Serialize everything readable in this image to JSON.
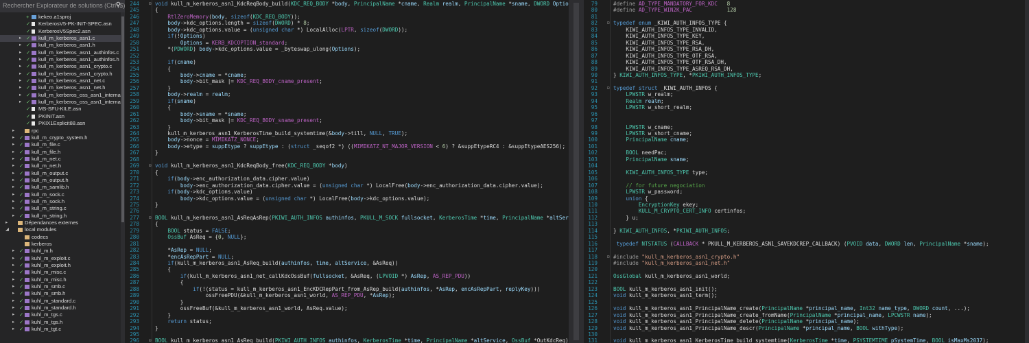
{
  "explorer": {
    "search_placeholder": "Rechercher Explorateur de solutions (Ctrl+$)",
    "items": [
      {
        "name": "kekeo.a1sproj",
        "depth": 3,
        "type": "proj",
        "check": "+",
        "caret": "",
        "sel": false
      },
      {
        "name": "KerberosV5-PK-INIT-SPEC.asn",
        "depth": 3,
        "type": "file",
        "check": "✓",
        "caret": "",
        "sel": false
      },
      {
        "name": "KerberosV5Spec2.asn",
        "depth": 3,
        "type": "file",
        "check": "✓",
        "caret": "",
        "sel": false
      },
      {
        "name": "kull_m_kerberos_asn1.c",
        "depth": 3,
        "type": "c",
        "check": "✓",
        "caret": "▸",
        "sel": true
      },
      {
        "name": "kull_m_kerberos_asn1.h",
        "depth": 3,
        "type": "h",
        "check": "✓",
        "caret": "▸",
        "sel": false
      },
      {
        "name": "kull_m_kerberos_asn1_authinfos.c",
        "depth": 3,
        "type": "c",
        "check": "✓",
        "caret": "▸",
        "sel": false
      },
      {
        "name": "kull_m_kerberos_asn1_authinfos.h",
        "depth": 3,
        "type": "h",
        "check": "✓",
        "caret": "▸",
        "sel": false
      },
      {
        "name": "kull_m_kerberos_asn1_crypto.c",
        "depth": 3,
        "type": "c",
        "check": "✓",
        "caret": "▸",
        "sel": false
      },
      {
        "name": "kull_m_kerberos_asn1_crypto.h",
        "depth": 3,
        "type": "h",
        "check": "✓",
        "caret": "▸",
        "sel": false
      },
      {
        "name": "kull_m_kerberos_asn1_net.c",
        "depth": 3,
        "type": "c",
        "check": "✓",
        "caret": "▸",
        "sel": false
      },
      {
        "name": "kull_m_kerberos_asn1_net.h",
        "depth": 3,
        "type": "h",
        "check": "✓",
        "caret": "▸",
        "sel": false
      },
      {
        "name": "kull_m_kerberos_oss_asn1_internal.h",
        "depth": 3,
        "type": "h",
        "check": "✓",
        "caret": "▸",
        "sel": false
      },
      {
        "name": "kull_m_kerberos_oss_asn1_internal_w",
        "depth": 3,
        "type": "h",
        "check": "✓",
        "caret": "▸",
        "sel": false
      },
      {
        "name": "MS-SFU-KILE.asn",
        "depth": 3,
        "type": "file",
        "check": "✓",
        "caret": "",
        "sel": false
      },
      {
        "name": "PKINIT.asn",
        "depth": 3,
        "type": "file",
        "check": "✓",
        "caret": "",
        "sel": false
      },
      {
        "name": "PKIX1Explicit88.asn",
        "depth": 3,
        "type": "file",
        "check": "✓",
        "caret": "",
        "sel": false
      },
      {
        "name": "rpc",
        "depth": 2,
        "type": "folder",
        "check": "",
        "caret": "▸",
        "sel": false
      },
      {
        "name": "kull_m_crypto_system.h",
        "depth": 2,
        "type": "h",
        "check": "✓",
        "caret": "▸",
        "sel": false
      },
      {
        "name": "kull_m_file.c",
        "depth": 2,
        "type": "c",
        "check": "✓",
        "caret": "▸",
        "sel": false
      },
      {
        "name": "kull_m_file.h",
        "depth": 2,
        "type": "h",
        "check": "✓",
        "caret": "▸",
        "sel": false
      },
      {
        "name": "kull_m_net.c",
        "depth": 2,
        "type": "c",
        "check": "✓",
        "caret": "▸",
        "sel": false
      },
      {
        "name": "kull_m_net.h",
        "depth": 2,
        "type": "h",
        "check": "✓",
        "caret": "▸",
        "sel": false
      },
      {
        "name": "kull_m_output.c",
        "depth": 2,
        "type": "c",
        "check": "✓",
        "caret": "▸",
        "sel": false
      },
      {
        "name": "kull_m_output.h",
        "depth": 2,
        "type": "h",
        "check": "✓",
        "caret": "▸",
        "sel": false
      },
      {
        "name": "kull_m_samlib.h",
        "depth": 2,
        "type": "h",
        "check": "✓",
        "caret": "▸",
        "sel": false
      },
      {
        "name": "kull_m_sock.c",
        "depth": 2,
        "type": "c",
        "check": "✓",
        "caret": "▸",
        "sel": false
      },
      {
        "name": "kull_m_sock.h",
        "depth": 2,
        "type": "h",
        "check": "✓",
        "caret": "▸",
        "sel": false
      },
      {
        "name": "kull_m_string.c",
        "depth": 2,
        "type": "c",
        "check": "✓",
        "caret": "▸",
        "sel": false
      },
      {
        "name": "kull_m_string.h",
        "depth": 2,
        "type": "h",
        "check": "✓",
        "caret": "▸",
        "sel": false
      },
      {
        "name": "Dépendances externes",
        "depth": 1,
        "type": "dep",
        "check": "",
        "caret": "▸",
        "sel": false
      },
      {
        "name": "local modules",
        "depth": 1,
        "type": "folder",
        "check": "",
        "caret": "◢",
        "sel": false
      },
      {
        "name": "codecs",
        "depth": 2,
        "type": "folder",
        "check": "",
        "caret": "",
        "sel": false
      },
      {
        "name": "kerberos",
        "depth": 2,
        "type": "folder",
        "check": "",
        "caret": "",
        "sel": false
      },
      {
        "name": "kuhl_m.h",
        "depth": 2,
        "type": "h",
        "check": "✓",
        "caret": "▸",
        "sel": false
      },
      {
        "name": "kuhl_m_exploit.c",
        "depth": 2,
        "type": "c",
        "check": "✓",
        "caret": "▸",
        "sel": false
      },
      {
        "name": "kuhl_m_exploit.h",
        "depth": 2,
        "type": "h",
        "check": "✓",
        "caret": "▸",
        "sel": false
      },
      {
        "name": "kuhl_m_misc.c",
        "depth": 2,
        "type": "c",
        "check": "✓",
        "caret": "▸",
        "sel": false
      },
      {
        "name": "kuhl_m_misc.h",
        "depth": 2,
        "type": "h",
        "check": "✓",
        "caret": "▸",
        "sel": false
      },
      {
        "name": "kuhl_m_smb.c",
        "depth": 2,
        "type": "c",
        "check": "✓",
        "caret": "▸",
        "sel": false
      },
      {
        "name": "kuhl_m_smb.h",
        "depth": 2,
        "type": "h",
        "check": "✓",
        "caret": "▸",
        "sel": false
      },
      {
        "name": "kuhl_m_standard.c",
        "depth": 2,
        "type": "c",
        "check": "✓",
        "caret": "▸",
        "sel": false
      },
      {
        "name": "kuhl_m_standard.h",
        "depth": 2,
        "type": "h",
        "check": "✓",
        "caret": "▸",
        "sel": false
      },
      {
        "name": "kuhl_m_tgs.c",
        "depth": 2,
        "type": "c",
        "check": "✓",
        "caret": "▸",
        "sel": false
      },
      {
        "name": "kuhl_m_tgs.h",
        "depth": 2,
        "type": "h",
        "check": "✓",
        "caret": "▸",
        "sel": false
      },
      {
        "name": "kuhl_m_tgt.c",
        "depth": 2,
        "type": "c",
        "check": "✓",
        "caret": "▸",
        "sel": false
      }
    ]
  },
  "colors": {
    "keyword": "#569cd6",
    "type": "#4ec9b0",
    "macro": "#bd63c5",
    "string": "#d69d85",
    "comment": "#57a64a",
    "number": "#b5cea8",
    "text": "#dcdcdc",
    "linenum": "#2b91af",
    "csharp_check": "#6fc26f",
    "c_icon": "#9b77c7",
    "h_icon": "#9b77c7",
    "folder": "#dcb67a"
  },
  "left_code": {
    "lines": [
      {
        "n": "244",
        "f": "⊟",
        "t": "void kull_m_kerberos_asn1_KdcReqBody_build(KDC_REQ_BODY *body, PrincipalName *cname, Realm realm, PrincipalName *sname, DWORD Options, struct _seq"
      },
      {
        "n": "245",
        "t": "{"
      },
      {
        "n": "246",
        "t": "    RtlZeroMemory(body, sizeof(KDC_REQ_BODY));"
      },
      {
        "n": "247",
        "t": "    body->kdc_options.length = sizeof(DWORD) * 8;"
      },
      {
        "n": "248",
        "t": "    body->kdc_options.value = (unsigned char *) LocalAlloc(LPTR, sizeof(DWORD));"
      },
      {
        "n": "249",
        "t": "    if(!Options)"
      },
      {
        "n": "250",
        "t": "        Options = KERB_KDCOPTION_standard;"
      },
      {
        "n": "251",
        "t": "    *(PDWORD) body->kdc_options.value = _byteswap_ulong(Options);"
      },
      {
        "n": "252",
        "t": ""
      },
      {
        "n": "253",
        "t": "    if(cname)"
      },
      {
        "n": "254",
        "t": "    {"
      },
      {
        "n": "255",
        "t": "        body->cname = *cname;"
      },
      {
        "n": "256",
        "t": "        body->bit_mask |= KDC_REQ_BODY_cname_present;"
      },
      {
        "n": "257",
        "t": "    }"
      },
      {
        "n": "258",
        "t": "    body->realm = realm;"
      },
      {
        "n": "259",
        "t": "    if(sname)"
      },
      {
        "n": "260",
        "t": "    {"
      },
      {
        "n": "261",
        "t": "        body->sname = *sname;"
      },
      {
        "n": "262",
        "t": "        body->bit_mask |= KDC_REQ_BODY_sname_present;"
      },
      {
        "n": "263",
        "t": "    }"
      },
      {
        "n": "264",
        "t": "    kull_m_kerberos_asn1_KerberosTime_build_systemtime(&body->till, NULL, TRUE);"
      },
      {
        "n": "265",
        "t": "    body->nonce = MIMIKATZ_NONCE;"
      },
      {
        "n": "266",
        "t": "    body->etype = suppEtype ? suppEtype : (struct _seqof2 *) ((MIMIKATZ_NT_MAJOR_VERSION < 6) ? &suppEtypeRC4 : &suppEtypeAES256);"
      },
      {
        "n": "267",
        "t": "}"
      },
      {
        "n": "268",
        "t": ""
      },
      {
        "n": "269",
        "f": "⊟",
        "t": "void kull_m_kerberos_asn1_KdcReqBody_free(KDC_REQ_BODY *body)"
      },
      {
        "n": "270",
        "t": "{"
      },
      {
        "n": "271",
        "t": "    if(body->enc_authorization_data.cipher.value)"
      },
      {
        "n": "272",
        "t": "        body->enc_authorization_data.cipher.value = (unsigned char *) LocalFree(body->enc_authorization_data.cipher.value);"
      },
      {
        "n": "273",
        "t": "    if(body->kdc_options.value)"
      },
      {
        "n": "274",
        "t": "        body->kdc_options.value = (unsigned char *) LocalFree(body->kdc_options.value);"
      },
      {
        "n": "275",
        "t": "}"
      },
      {
        "n": "276",
        "t": ""
      },
      {
        "n": "277",
        "f": "⊟",
        "t": "BOOL kull_m_kerberos_asn1_AsReqAsRep(PKIWI_AUTH_INFOS authinfos, PKULL_M_SOCK fullsocket, KerberosTime *time, PrincipalName *altService, AS_REP **"
      },
      {
        "n": "278",
        "t": "{"
      },
      {
        "n": "279",
        "t": "    BOOL status = FALSE;"
      },
      {
        "n": "280",
        "t": "    OssBuf AsReq = {0, NULL};"
      },
      {
        "n": "281",
        "t": ""
      },
      {
        "n": "282",
        "t": "    *AsRep = NULL;"
      },
      {
        "n": "283",
        "t": "    *encAsRepPart = NULL;"
      },
      {
        "n": "284",
        "t": "    if(kull_m_kerberos_asn1_AsReq_build(authinfos, time, altService, &AsReq))"
      },
      {
        "n": "285",
        "t": "    {"
      },
      {
        "n": "286",
        "t": "        if(kull_m_kerberos_asn1_net_callKdcOssBuf(fullsocket, &AsReq, (LPVOID *) AsRep, AS_REP_PDU))"
      },
      {
        "n": "287",
        "t": "        {"
      },
      {
        "n": "288",
        "t": "            if(!(status = kull_m_kerberos_asn1_EncKDCRepPart_from_AsRep_build(authinfos, *AsRep, encAsRepPart, replyKey)))"
      },
      {
        "n": "289",
        "t": "                ossFreePDU(&kull_m_kerberos_asn1_world, AS_REP_PDU, *AsRep);"
      },
      {
        "n": "290",
        "t": "        }"
      },
      {
        "n": "291",
        "t": "        ossFreeBuf(&kull_m_kerberos_asn1_world, AsReq.value);"
      },
      {
        "n": "292",
        "t": "    }"
      },
      {
        "n": "293",
        "t": "    return status;"
      },
      {
        "n": "294",
        "t": "}"
      },
      {
        "n": "295",
        "t": ""
      },
      {
        "n": "296",
        "f": "⊟",
        "t": "BOOL kull_m_kerberos_asn1_AsReq_build(PKIWI_AUTH_INFOS authinfos, KerberosTime *time, PrincipalName *altService, OssBuf *OutKdcReq)"
      }
    ]
  },
  "right_code": {
    "lines": [
      {
        "n": "79",
        "t": "#define AD_TYPE_MANDATORY_FOR_KDC   8"
      },
      {
        "n": "80",
        "t": "#define AD_TYPE_WIN2K_PAC           128"
      },
      {
        "n": "81",
        "t": ""
      },
      {
        "n": "82",
        "f": "⊟",
        "t": "typedef enum _KIWI_AUTH_INFOS_TYPE {"
      },
      {
        "n": "83",
        "t": "    KIWI_AUTH_INFOS_TYPE_INVALID,"
      },
      {
        "n": "84",
        "t": "    KIWI_AUTH_INFOS_TYPE_KEY,"
      },
      {
        "n": "85",
        "t": "    KIWI_AUTH_INFOS_TYPE_RSA,"
      },
      {
        "n": "86",
        "t": "    KIWI_AUTH_INFOS_TYPE_RSA_DH,"
      },
      {
        "n": "87",
        "t": "    KIWI_AUTH_INFOS_TYPE_OTF_RSA,"
      },
      {
        "n": "88",
        "t": "    KIWI_AUTH_INFOS_TYPE_OTF_RSA_DH,"
      },
      {
        "n": "89",
        "t": "    KIWI_AUTH_INFOS_TYPE_ASREQ_RSA_DH,"
      },
      {
        "n": "90",
        "t": "} KIWI_AUTH_INFOS_TYPE, *PKIWI_AUTH_INFOS_TYPE;"
      },
      {
        "n": "91",
        "t": ""
      },
      {
        "n": "92",
        "f": "⊟",
        "t": "typedef struct _KIWI_AUTH_INFOS {"
      },
      {
        "n": "93",
        "t": "    LPWSTR w_realm;"
      },
      {
        "n": "94",
        "t": "    Realm realm;"
      },
      {
        "n": "95",
        "t": "    LPWSTR w_short_realm;"
      },
      {
        "n": "96",
        "t": ""
      },
      {
        "n": "97",
        "t": ""
      },
      {
        "n": "98",
        "t": "    LPWSTR w_cname;"
      },
      {
        "n": "99",
        "t": "    LPWSTR w_short_cname;"
      },
      {
        "n": "100",
        "t": "    PrincipalName cname;"
      },
      {
        "n": "101",
        "t": ""
      },
      {
        "n": "102",
        "t": "    BOOL needPac;"
      },
      {
        "n": "103",
        "t": "    PrincipalName sname;"
      },
      {
        "n": "104",
        "t": ""
      },
      {
        "n": "105",
        "t": "    KIWI_AUTH_INFOS_TYPE type;"
      },
      {
        "n": "106",
        "t": ""
      },
      {
        "n": "107",
        "t": "    // for future negociation"
      },
      {
        "n": "108",
        "t": "    LPWSTR w_password;"
      },
      {
        "n": "109",
        "t": "    union {"
      },
      {
        "n": "110",
        "t": "        EncryptionKey ekey;"
      },
      {
        "n": "111",
        "t": "        KULL_M_CRYPTO_CERT_INFO certinfos;"
      },
      {
        "n": "112",
        "t": "    } u;"
      },
      {
        "n": "113",
        "t": ""
      },
      {
        "n": "114",
        "t": "} KIWI_AUTH_INFOS, *PKIWI_AUTH_INFOS;"
      },
      {
        "n": "115",
        "t": ""
      },
      {
        "n": "116",
        "t": " typedef NTSTATUS (CALLBACK * PKULL_M_KERBEROS_ASN1_SAVEKDCREP_CALLBACK) (PVOID data, DWORD len, PrincipalName *sname);"
      },
      {
        "n": "117",
        "t": ""
      },
      {
        "n": "118",
        "f": "⊟",
        "t": "#include \"kull_m_kerberos_asn1_crypto.h\""
      },
      {
        "n": "119",
        "t": "#include \"kull_m_kerberos_asn1_net.h\""
      },
      {
        "n": "120",
        "t": ""
      },
      {
        "n": "121",
        "t": "OssGlobal kull_m_kerberos_asn1_world;"
      },
      {
        "n": "122",
        "t": ""
      },
      {
        "n": "123",
        "t": "BOOL kull_m_kerberos_asn1_init();"
      },
      {
        "n": "124",
        "t": "void kull_m_kerberos_asn1_term();"
      },
      {
        "n": "125",
        "t": ""
      },
      {
        "n": "126",
        "t": "void kull_m_kerberos_asn1_PrincipalName_create(PrincipalName *principal_name, Int32 name_type, DWORD count, ...);"
      },
      {
        "n": "127",
        "t": "void kull_m_kerberos_asn1_PrincipalName_create_fromName(PrincipalName *principal_name, LPCWSTR name);"
      },
      {
        "n": "128",
        "t": "void kull_m_kerberos_asn1_PrincipalName_delete(PrincipalName *principal_name);"
      },
      {
        "n": "129",
        "t": "void kull_m_kerberos_asn1_PrincipalName_descr(PrincipalName *principal_name, BOOL withType);"
      },
      {
        "n": "130",
        "t": ""
      },
      {
        "n": "131",
        "t": "void kull_m_kerberos_asn1_KerberosTime_build_systemtime(KerberosTime *time, PSYSTEMTIME pSystemTime, BOOL isMaxMs2037);"
      }
    ]
  }
}
